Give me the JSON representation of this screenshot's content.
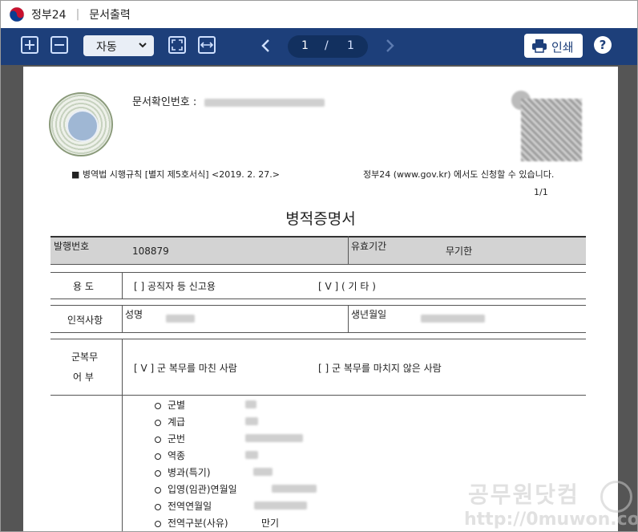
{
  "window": {
    "app_name": "정부24",
    "title": "문서출력"
  },
  "toolbar": {
    "zoom_value": "자동",
    "page_current": "1",
    "page_separator": "/",
    "page_total": "1",
    "print_label": "인쇄",
    "help_label": "?"
  },
  "document": {
    "doc_no_label": "문서확인번호 :",
    "law_text": "■ 병역법 시행규칙 [별지 제5호서식] <2019. 2. 27.>",
    "issue_text": "정부24 (www.gov.kr) 에서도 신청할 수 있습니다.",
    "page_indicator": "1/1",
    "title": "병적증명서",
    "issue_no_label": "발행번호",
    "issue_no_value": "108879",
    "validity_label": "유효기간",
    "validity_value": "무기한",
    "purpose_label": "용  도",
    "purpose_opt1": "[     ] 공직자 등 신고용",
    "purpose_opt2": "[  V  ] ( 기 타 )",
    "person_label": "인적사항",
    "name_label": "성명",
    "birth_label": "생년월일",
    "service_label_1": "군복무",
    "service_label_2": "어  부",
    "service_opt1": "[  V  ] 군 복무를 마친 사람",
    "service_opt2": "[     ] 군 복무를 마치지 않은 사람",
    "details": [
      {
        "label": "군별",
        "value": ""
      },
      {
        "label": "계급",
        "value": ""
      },
      {
        "label": "군번",
        "value": ""
      },
      {
        "label": "역종",
        "value": ""
      },
      {
        "label": "병과(특기)",
        "value": ""
      },
      {
        "label": "입영(임관)연월일",
        "value": ""
      },
      {
        "label": "전역연월일",
        "value": ""
      },
      {
        "label": "전역구분(사유)",
        "value": "만기"
      }
    ]
  },
  "watermark": {
    "line1": "공무원닷컴",
    "line2": "http://0muwon.com"
  },
  "colors": {
    "toolbar": "#1d3f7a",
    "viewer_bg": "#555555",
    "accent": "#cfe0ff"
  }
}
